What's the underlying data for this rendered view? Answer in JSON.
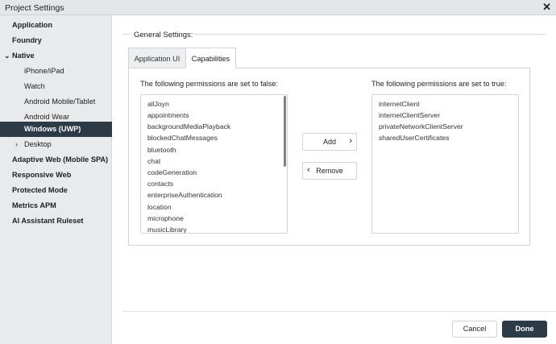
{
  "window": {
    "title": "Project Settings",
    "close_glyph": "✕"
  },
  "sidebar": {
    "items": [
      {
        "label": "Application"
      },
      {
        "label": "Foundry"
      },
      {
        "label": "Native",
        "expanded": true
      },
      {
        "label": "iPhone/iPad"
      },
      {
        "label": "Watch"
      },
      {
        "label": "Android Mobile/Tablet"
      },
      {
        "label": "Android Wear"
      },
      {
        "label": "Windows (UWP)",
        "selected": true
      },
      {
        "label": "Desktop",
        "expanded": false
      },
      {
        "label": "Adaptive Web (Mobile SPA)"
      },
      {
        "label": "Responsive Web"
      },
      {
        "label": "Protected Mode"
      },
      {
        "label": "Metrics APM"
      },
      {
        "label": "AI Assistant Ruleset"
      }
    ]
  },
  "main": {
    "section_title": "General Settings:",
    "tabs": [
      {
        "label": "Application UI"
      },
      {
        "label": "Capabilities",
        "active": true
      }
    ],
    "false_label": "The following permissions are set to false:",
    "true_label": "The following permissions are set to true:",
    "false_permissions": [
      "allJoyn",
      "appointments",
      "backgroundMediaPlayback",
      "blockedChatMessages",
      "bluetooth",
      "chat",
      "codeGeneration",
      "contacts",
      "enterpriseAuthentication",
      "location",
      "microphone",
      "musicLibrary"
    ],
    "true_permissions": [
      "internetClient",
      "internetClientServer",
      "privateNetworkClientServer",
      "sharedUserCertificates"
    ],
    "add_label": "Add",
    "remove_label": "Remove"
  },
  "footer": {
    "cancel_label": "Cancel",
    "done_label": "Done"
  },
  "colors": {
    "accent": "#2d3b47",
    "sidebar_bg": "#e8eaec",
    "border": "#cfd3d6"
  }
}
